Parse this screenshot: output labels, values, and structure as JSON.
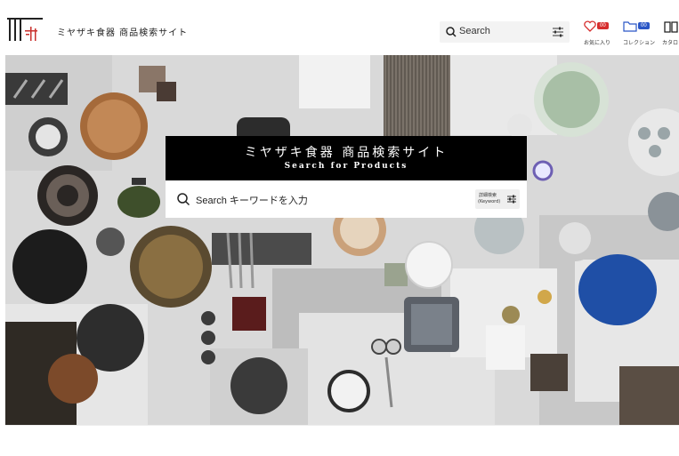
{
  "header": {
    "site_name": "ミヤザキ食器 商品検索サイト",
    "search_label": "Search",
    "favorites": {
      "count": "00",
      "label": "お気に入り"
    },
    "collection": {
      "count": "00",
      "label": "コレクション"
    },
    "catalog": {
      "label": "カタロ"
    }
  },
  "hero": {
    "title_jp": "ミヤザキ食器 商品検索サイト",
    "title_en": "Search for Products",
    "search_label": "Search キーワードを入力",
    "advanced_line1": "詳細検索",
    "advanced_line2": "(Keyword)"
  },
  "colors": {
    "badge_red": "#d62d2d",
    "badge_blue": "#2a56c6",
    "logo_red": "#c9302c"
  }
}
